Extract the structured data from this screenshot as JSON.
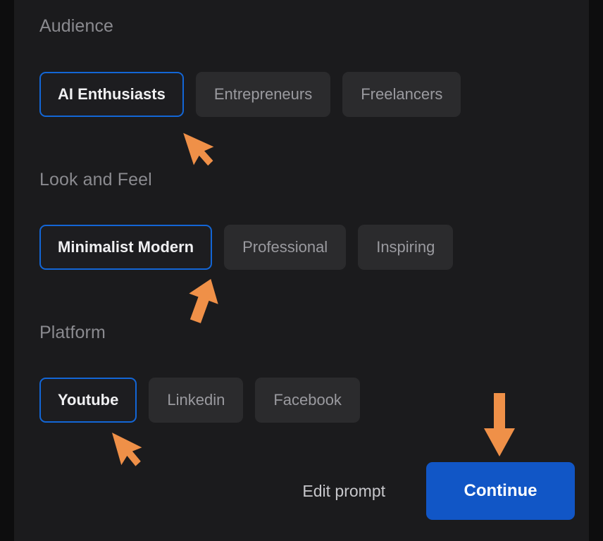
{
  "theme": {
    "page_background": "#0d0d0e",
    "panel_background": "#1b1b1d",
    "chip_unselected_background": "#2b2b2d",
    "chip_unselected_text": "#9a9a9f",
    "chip_selected_background": "#1d1d20",
    "chip_selected_border": "#1366d6",
    "chip_selected_text": "#f0f0f2",
    "section_title_color": "#8a8a8f",
    "primary_button_background": "#1156c6",
    "primary_button_text": "#ffffff",
    "secondary_button_text": "#c7c7cb",
    "annotation_arrow_color": "#ef9048"
  },
  "sections": [
    {
      "id": "audience",
      "title": "Audience",
      "options": [
        {
          "label": "AI Enthusiasts",
          "selected": true
        },
        {
          "label": "Entrepreneurs",
          "selected": false
        },
        {
          "label": "Freelancers",
          "selected": false
        }
      ]
    },
    {
      "id": "look-and-feel",
      "title": "Look and Feel",
      "options": [
        {
          "label": "Minimalist Modern",
          "selected": true
        },
        {
          "label": "Professional",
          "selected": false
        },
        {
          "label": "Inspiring",
          "selected": false
        }
      ]
    },
    {
      "id": "platform",
      "title": "Platform",
      "options": [
        {
          "label": "Youtube",
          "selected": true
        },
        {
          "label": "Linkedin",
          "selected": false
        },
        {
          "label": "Facebook",
          "selected": false
        }
      ]
    }
  ],
  "actions": {
    "edit_prompt_label": "Edit prompt",
    "continue_label": "Continue"
  },
  "annotations": [
    {
      "icon": "cursor-arrow-icon",
      "points_to": "AI Enthusiasts"
    },
    {
      "icon": "arrow-up-left-icon",
      "points_to": "Minimalist Modern"
    },
    {
      "icon": "cursor-arrow-icon",
      "points_to": "Youtube"
    },
    {
      "icon": "arrow-down-icon",
      "points_to": "Continue"
    }
  ]
}
